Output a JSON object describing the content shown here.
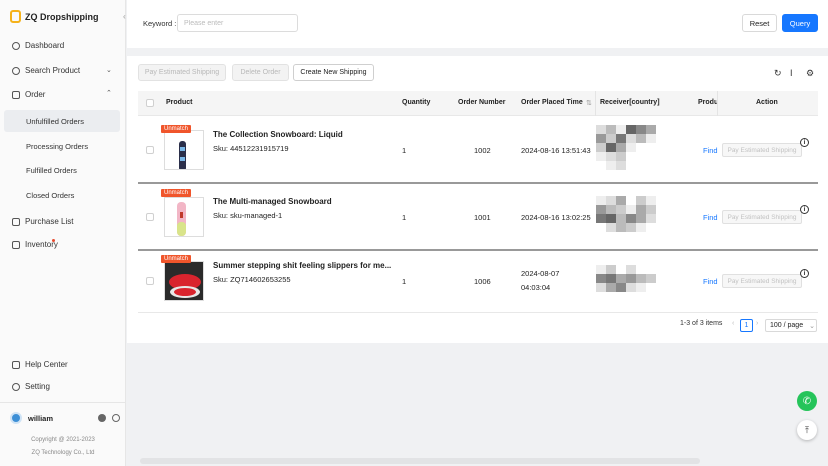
{
  "brand": {
    "name": "ZQ Dropshipping",
    "collapse_icon": "‹"
  },
  "sidebar": {
    "items": [
      {
        "label": "Dashboard"
      },
      {
        "label": "Search Product"
      },
      {
        "label": "Order"
      },
      {
        "label": "Purchase List"
      },
      {
        "label": "Inventory"
      }
    ],
    "order_sub": [
      {
        "label": "Unfulfilled Orders"
      },
      {
        "label": "Processing Orders"
      },
      {
        "label": "Fulfilled Orders"
      },
      {
        "label": "Closed Orders"
      }
    ],
    "bottom": [
      {
        "label": "Help Center"
      },
      {
        "label": "Setting"
      }
    ],
    "user": {
      "name": "william"
    },
    "copyright": "Copyright @ 2021-2023",
    "company": "ZQ Technology Co., Ltd"
  },
  "search": {
    "keyword_label": "Keyword :",
    "placeholder": "Please enter",
    "reset_label": "Reset",
    "query_label": "Query"
  },
  "toolbar": {
    "pay_label": "Pay Estimated Shipping",
    "delete_label": "Delete Order",
    "create_label": "Create New Shipping"
  },
  "table": {
    "headers": {
      "product": "Product",
      "quantity": "Quantity",
      "order_number": "Order Number",
      "order_time": "Order Placed Time",
      "receiver": "Receiver[country]",
      "product_link": "Produ",
      "action": "Action"
    },
    "rows": [
      {
        "badge": "Unmatch",
        "name": "The Collection Snowboard: Liquid",
        "sku": "Sku: 44512231915719",
        "quantity": "1",
        "order_number": "1002",
        "time": "2024-08-16 13:51:43",
        "time2": "",
        "find": "Find",
        "action": "Pay Estimated Shipping"
      },
      {
        "badge": "Unmatch",
        "name": "The Multi-managed Snowboard",
        "sku": "Sku: sku-managed-1",
        "quantity": "1",
        "order_number": "1001",
        "time": "2024-08-16 13:02:25",
        "time2": "",
        "find": "Find",
        "action": "Pay Estimated Shipping"
      },
      {
        "badge": "Unmatch",
        "name": "Summer stepping shit feeling slippers for me...",
        "sku": "Sku: ZQ714602653255",
        "quantity": "1",
        "order_number": "1006",
        "time": "2024-08-07",
        "time2": "04:03:04",
        "find": "Find",
        "action": "Pay Estimated Shipping"
      }
    ]
  },
  "pagination": {
    "summary": "1-3 of 3 items",
    "current_page": "1",
    "page_size": "100 / page"
  },
  "colors": {
    "primary": "#1677ff",
    "badge": "#f0552b",
    "whatsapp": "#25c45a"
  }
}
